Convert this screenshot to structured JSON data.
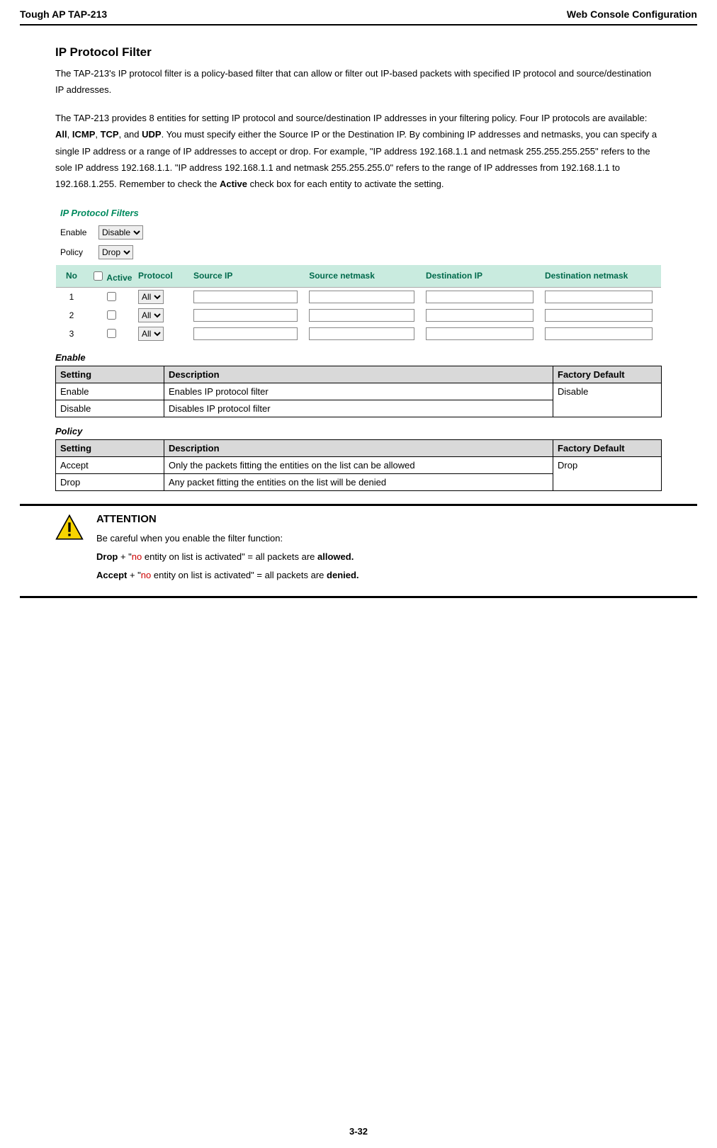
{
  "header": {
    "left": "Tough AP TAP-213",
    "right": "Web Console Configuration"
  },
  "section": {
    "title": "IP Protocol Filter",
    "para1": "The TAP-213's IP protocol filter is a policy-based filter that can allow or filter out IP-based packets with specified IP protocol and source/destination IP addresses.",
    "para2_a": "The TAP-213 provides 8 entities for setting IP protocol and source/destination IP addresses in your filtering policy. Four IP protocols are available: ",
    "p2_all": "All",
    "p2_sep1": ", ",
    "p2_icmp": "ICMP",
    "p2_sep2": ", ",
    "p2_tcp": "TCP",
    "p2_sep3": ", and ",
    "p2_udp": "UDP",
    "para2_b": ". You must specify either the Source IP or the Destination IP. By combining IP addresses and netmasks, you can specify a single IP address or a range of IP addresses to accept or drop. For example, \"IP address 192.168.1.1 and netmask 255.255.255.255\" refers to the sole IP address 192.168.1.1. \"IP address 192.168.1.1 and netmask 255.255.255.0\" refers to the range of IP addresses from 192.168.1.1 to 192.168.1.255. Remember to check the ",
    "p2_active": "Active",
    "para2_c": " check box for each entity to activate the setting."
  },
  "panel": {
    "title": "IP Protocol Filters",
    "enable_label": "Enable",
    "enable_value": "Disable",
    "policy_label": "Policy",
    "policy_value": "Drop",
    "headers": {
      "no": "No",
      "active": "Active",
      "protocol": "Protocol",
      "source_ip": "Source IP",
      "source_mask": "Source netmask",
      "dest_ip": "Destination IP",
      "dest_mask": "Destination netmask"
    },
    "rows": [
      {
        "no": "1",
        "protocol": "All"
      },
      {
        "no": "2",
        "protocol": "All"
      },
      {
        "no": "3",
        "protocol": "All"
      }
    ]
  },
  "tables": {
    "enable": {
      "label": "Enable",
      "h_set": "Setting",
      "h_desc": "Description",
      "h_def": "Factory Default",
      "r1_set": "Enable",
      "r1_desc": "Enables IP protocol filter",
      "r2_set": "Disable",
      "r2_desc": "Disables IP protocol filter",
      "def": "Disable"
    },
    "policy": {
      "label": "Policy",
      "h_set": "Setting",
      "h_desc": "Description",
      "h_def": "Factory Default",
      "r1_set": "Accept",
      "r1_desc": "Only the packets fitting the entities on the list can be allowed",
      "r2_set": "Drop",
      "r2_desc": "Any packet fitting the entities on the list will be denied",
      "def": "Drop"
    }
  },
  "attention": {
    "title": "ATTENTION",
    "line1": "Be careful when you enable the filter function:",
    "l2_drop": "Drop",
    "l2_plus": " + \"",
    "l2_no": "no",
    "l2_mid": " entity on list is activated\" = all packets are ",
    "l2_allowed": "allowed.",
    "l3_accept": "Accept",
    "l3_plus": " + \"",
    "l3_no": "no",
    "l3_mid": " entity on list is activated\" = all packets are ",
    "l3_denied": "denied."
  },
  "page_number": "3-32"
}
